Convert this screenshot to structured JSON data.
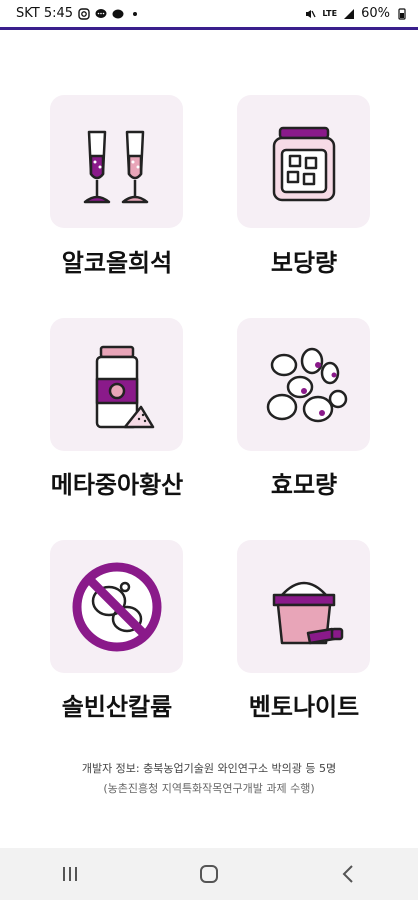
{
  "status_bar": {
    "carrier_time": "SKT 5:45",
    "battery": "60%",
    "network": "LTE"
  },
  "menu": [
    {
      "label": "알코올희석",
      "icon": "wine-glasses-icon"
    },
    {
      "label": "보당량",
      "icon": "sugar-jar-icon"
    },
    {
      "label": "메타중아황산",
      "icon": "metabisulfite-bottle-icon"
    },
    {
      "label": "효모량",
      "icon": "yeast-cells-icon"
    },
    {
      "label": "솔빈산칼륨",
      "icon": "potassium-sorbate-prohibited-icon"
    },
    {
      "label": "벤토나이트",
      "icon": "bentonite-sack-icon"
    }
  ],
  "footer": {
    "developer_info": "개발자 정보: 충북농업기술원 와인연구소 박의광 등 5명",
    "project_info": "(농촌진흥청 지역특화작목연구개발 과제 수행)"
  },
  "nav": {
    "recents": "recents-icon",
    "home": "home-icon",
    "back": "back-icon"
  },
  "colors": {
    "accent_purple": "#8a1a8a",
    "tile_bg": "#f6eff5",
    "pink": "#e8a5b8"
  }
}
